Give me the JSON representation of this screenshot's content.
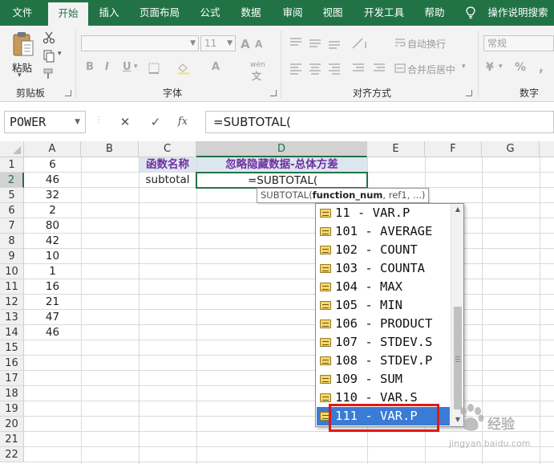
{
  "ribbon_tabs": [
    "文件",
    "开始",
    "插入",
    "页面布局",
    "公式",
    "数据",
    "审阅",
    "视图",
    "开发工具",
    "帮助"
  ],
  "active_tab": "开始",
  "tell_me": "操作说明搜索",
  "ribbon": {
    "paste_label": "粘贴",
    "clipboard_label": "剪贴板",
    "font_label": "字体",
    "font_size": "11",
    "font_grow": "A",
    "font_shrink": "A",
    "bold": "B",
    "italic": "I",
    "underline": "U",
    "wen": "wén",
    "align_label": "对齐方式",
    "wrap_text": "自动换行",
    "merge_center": "合并后居中",
    "number_label": "数字",
    "number_format": "常规",
    "currency": "¥",
    "percent": "%",
    "comma": ","
  },
  "formula_bar": {
    "name_box": "POWER",
    "cancel": "✕",
    "enter": "✓",
    "fx": "fx",
    "formula": "=SUBTOTAL("
  },
  "grid": {
    "columns": [
      "A",
      "B",
      "C",
      "D",
      "E",
      "F",
      "G"
    ],
    "selected_column": "D",
    "rows": [
      "1",
      "2",
      "5",
      "6",
      "7",
      "8",
      "9",
      "10",
      "11",
      "12",
      "13",
      "14",
      "15",
      "16",
      "17",
      "18",
      "19",
      "20",
      "21",
      "22"
    ],
    "selected_row": "2",
    "column_a_values": [
      "6",
      "46",
      "32",
      "2",
      "80",
      "42",
      "10",
      "1",
      "16",
      "21",
      "47",
      "46"
    ],
    "c1": "函数名称",
    "d1": "忽略隐藏数据-总体方差",
    "c2": "subtotal",
    "d2": "=SUBTOTAL("
  },
  "tooltip": {
    "prefix": "SUBTOTAL(",
    "bold_arg": "function_num",
    "rest": ", ref1, ...)"
  },
  "autocomplete": {
    "items": [
      "11 - VAR.P",
      "101 - AVERAGE",
      "102 - COUNT",
      "103 - COUNTA",
      "104 - MAX",
      "105 - MIN",
      "106 - PRODUCT",
      "107 - STDEV.S",
      "108 - STDEV.P",
      "109 - SUM",
      "110 - VAR.S",
      "111 - VAR.P"
    ],
    "selected": "111 - VAR.P",
    "item_icon": "function-icon"
  },
  "colors": {
    "excel_green": "#217346",
    "header_purple": "#7030a0",
    "header_fill": "#dce6f1",
    "selection_blue": "#3a7bd5",
    "highlight_red": "#e01818"
  },
  "watermark": {
    "main": "经验",
    "sub": "jingyan.baidu.com"
  }
}
